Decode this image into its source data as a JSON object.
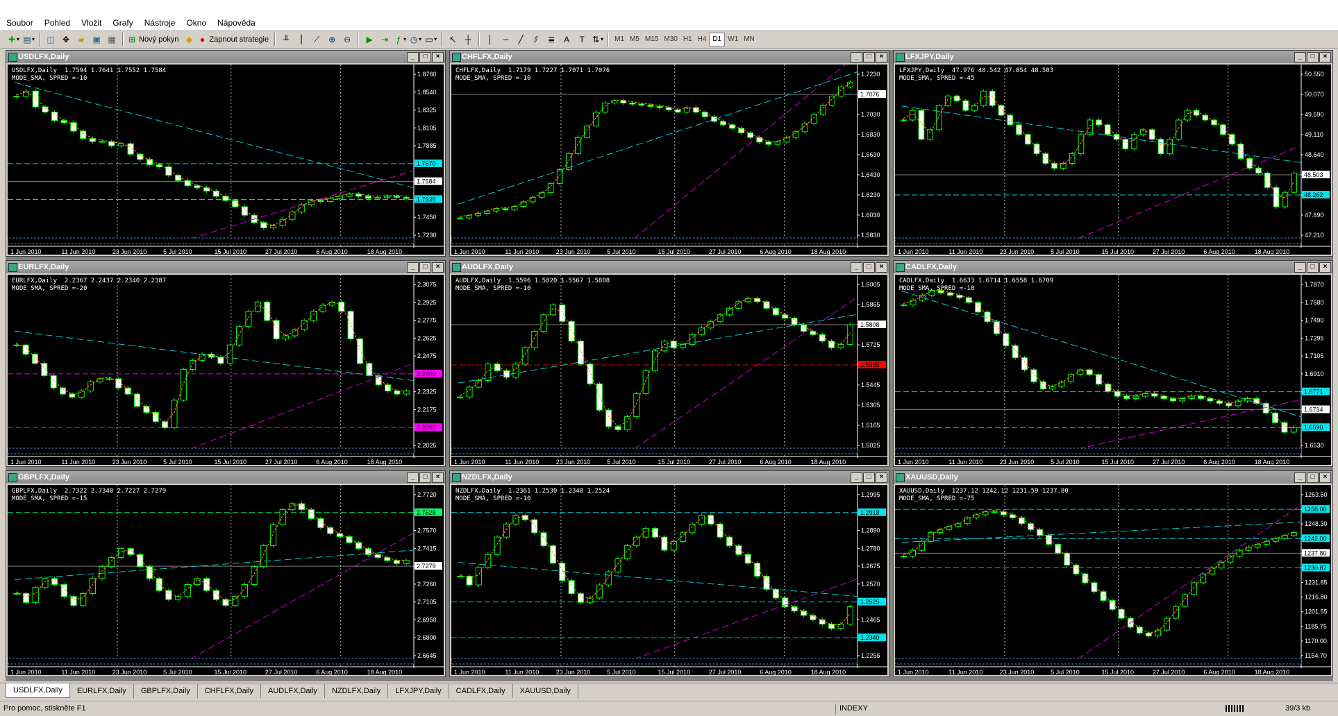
{
  "menu": [
    "Soubor",
    "Pohled",
    "Vložit",
    "Grafy",
    "Nástroje",
    "Okno",
    "Nápověda"
  ],
  "toolbar": {
    "new_order_label": "Nový pokyn",
    "autotrade_label": "Zapnout strategie",
    "timeframes": [
      "M1",
      "M5",
      "M15",
      "M30",
      "H1",
      "H4",
      "D1",
      "W1",
      "MN"
    ],
    "active_timeframe": "D1"
  },
  "date_labels": [
    "1 Jun 2010",
    "11 Jun 2010",
    "23 Jun 2010",
    "5 Jul 2010",
    "15 Jul 2010",
    "27 Jul 2010",
    "6 Aug 2010",
    "18 Aug 2010"
  ],
  "charts": [
    {
      "title": "USDLFX,Daily",
      "info": "USDLFX,Daily  1.7594 1.7641 1.7552 1.7584",
      "mode": "MODE_SMA, SPRED =-10",
      "price_labels": [
        "1.8760",
        "1.8540",
        "1.8325",
        "1.8105",
        "1.7885",
        "1.7670",
        "1.7584",
        "1.7535",
        "1.7450",
        "1.7230"
      ],
      "highlight_labels": [
        {
          "text": "1.7670",
          "color": "#00e5ee"
        },
        {
          "text": "1.7584",
          "color": "#ffffff"
        },
        {
          "text": "1.7535",
          "color": "#00e5ee"
        }
      ],
      "chart_data": {
        "type": "candlestick",
        "ymin": 1.723,
        "ymax": 1.876,
        "trend": [
          1.855,
          1.86,
          1.845,
          1.84,
          1.832,
          1.83,
          1.822,
          1.815,
          1.812,
          1.812,
          1.808,
          1.81,
          1.8,
          1.795,
          1.79,
          1.788,
          1.78,
          1.775,
          1.77,
          1.768,
          1.765,
          1.76,
          1.756,
          1.75,
          1.742,
          1.735,
          1.73,
          1.732,
          1.738,
          1.745,
          1.752,
          1.756,
          1.755,
          1.758,
          1.76,
          1.762,
          1.76,
          1.758,
          1.759,
          1.76,
          1.759,
          1.758
        ]
      }
    },
    {
      "title": "CHFLFX,Daily",
      "info": "CHFLFX,Daily  1.7179 1.7227 1.7071 1.7076",
      "mode": "MODE_SMA, SPRED =-10",
      "price_labels": [
        "1.7230",
        "1.7076",
        "1.7030",
        "1.6830",
        "1.6630",
        "1.6430",
        "1.6230",
        "1.6030",
        "1.5830"
      ],
      "highlight_labels": [
        {
          "text": "1.7076",
          "color": "#ffffff"
        }
      ],
      "chart_data": {
        "type": "candlestick",
        "ymin": 1.583,
        "ymax": 1.723,
        "trend": [
          1.598,
          1.6,
          1.602,
          1.604,
          1.606,
          1.605,
          1.608,
          1.612,
          1.616,
          1.62,
          1.628,
          1.64,
          1.654,
          1.668,
          1.678,
          1.69,
          1.698,
          1.7,
          1.698,
          1.697,
          1.696,
          1.695,
          1.694,
          1.692,
          1.69,
          1.694,
          1.69,
          1.686,
          1.682,
          1.679,
          1.676,
          1.672,
          1.668,
          1.664,
          1.662,
          1.664,
          1.668,
          1.673,
          1.68,
          1.688,
          1.696,
          1.704,
          1.712,
          1.716
        ]
      }
    },
    {
      "title": "LFXJPY,Daily",
      "info": "LFXJPY,Daily  47.976 48.542 47.854 48.503",
      "mode": "MODE_SMA, SPRED =-45",
      "price_labels": [
        "50.550",
        "50.070",
        "49.590",
        "49.110",
        "48.640",
        "48.503",
        "48.262",
        "47.690",
        "47.210"
      ],
      "highlight_labels": [
        {
          "text": "48.503",
          "color": "#ffffff"
        },
        {
          "text": "48.262",
          "color": "#00e5ee"
        }
      ],
      "chart_data": {
        "type": "candlestick",
        "ymin": 47.21,
        "ymax": 50.55,
        "trend": [
          49.6,
          49.8,
          49.2,
          49.4,
          49.9,
          50.1,
          50.0,
          49.8,
          49.9,
          50.2,
          49.9,
          49.7,
          49.5,
          49.3,
          49.1,
          48.9,
          48.7,
          48.6,
          48.7,
          48.9,
          49.3,
          49.6,
          49.5,
          49.3,
          49.2,
          49.0,
          49.3,
          49.4,
          49.2,
          48.9,
          49.2,
          49.6,
          49.8,
          49.7,
          49.6,
          49.5,
          49.3,
          49.1,
          48.8,
          48.6,
          48.5,
          48.2,
          47.8,
          48.1,
          48.5
        ]
      }
    },
    {
      "title": "EURLFX,Daily",
      "info": "EURLFX,Daily  2.2367 2.2437 2.2340 2.2387",
      "mode": "MODE_SMA, SPRED =-20",
      "price_labels": [
        "2.3075",
        "2.2925",
        "2.2775",
        "2.2625",
        "2.2475",
        "2.2400",
        "2.2325",
        "2.2175",
        "2.2098",
        "2.2025"
      ],
      "highlight_labels": [
        {
          "text": "2.2400",
          "color": "#ff00ff"
        },
        {
          "text": "2.2098",
          "color": "#ff00ff"
        }
      ],
      "chart_data": {
        "type": "candlestick",
        "ymin": 2.2025,
        "ymax": 2.3075,
        "trend": [
          2.268,
          2.262,
          2.256,
          2.248,
          2.24,
          2.236,
          2.234,
          2.238,
          2.244,
          2.246,
          2.246,
          2.24,
          2.236,
          2.228,
          2.224,
          2.218,
          2.214,
          2.232,
          2.252,
          2.258,
          2.262,
          2.26,
          2.256,
          2.268,
          2.28,
          2.29,
          2.296,
          2.284,
          2.272,
          2.274,
          2.278,
          2.284,
          2.29,
          2.294,
          2.296,
          2.29,
          2.272,
          2.256,
          2.248,
          2.242,
          2.238,
          2.236,
          2.238
        ]
      }
    },
    {
      "title": "AUDLFX,Daily",
      "info": "AUDLFX,Daily  1.5596 1.5820 1.5567 1.5808",
      "mode": "MODE_SMA, SPRED =-10",
      "price_labels": [
        "1.6005",
        "1.5865",
        "1.5808",
        "1.5725",
        "1.5585",
        "1.5445",
        "1.5305",
        "1.5165",
        "1.5025"
      ],
      "highlight_labels": [
        {
          "text": "1.5808",
          "color": "#ffffff"
        },
        {
          "text": "1.5585",
          "color": "#ff0000"
        }
      ],
      "chart_data": {
        "type": "candlestick",
        "ymin": 1.5025,
        "ymax": 1.6005,
        "trend": [
          1.532,
          1.538,
          1.542,
          1.552,
          1.548,
          1.544,
          1.552,
          1.562,
          1.572,
          1.582,
          1.588,
          1.578,
          1.566,
          1.552,
          1.54,
          1.524,
          1.514,
          1.512,
          1.52,
          1.534,
          1.548,
          1.56,
          1.566,
          1.562,
          1.564,
          1.57,
          1.574,
          1.578,
          1.582,
          1.586,
          1.59,
          1.592,
          1.59,
          1.586,
          1.582,
          1.58,
          1.576,
          1.572,
          1.57,
          1.566,
          1.562,
          1.564,
          1.576
        ]
      }
    },
    {
      "title": "CADLFX,Daily",
      "info": "CADLFX,Daily  1.6633 1.6714 1.6558 1.6709",
      "mode": "MODE_SMA, SPRED =-10",
      "price_labels": [
        "1.7870",
        "1.7680",
        "1.7490",
        "1.7295",
        "1.7105",
        "1.6910",
        "1.6771",
        "1.6734",
        "1.6590",
        "1.6530"
      ],
      "highlight_labels": [
        {
          "text": "1.6771",
          "color": "#00e5ee"
        },
        {
          "text": "1.6734",
          "color": "#ffffff"
        },
        {
          "text": "1.6590",
          "color": "#00e5ee"
        }
      ],
      "chart_data": {
        "type": "candlestick",
        "ymin": 1.653,
        "ymax": 1.787,
        "trend": [
          1.77,
          1.774,
          1.778,
          1.782,
          1.78,
          1.778,
          1.776,
          1.772,
          1.764,
          1.756,
          1.746,
          1.736,
          1.726,
          1.716,
          1.706,
          1.7,
          1.702,
          1.706,
          1.712,
          1.716,
          1.712,
          1.704,
          1.698,
          1.694,
          1.692,
          1.694,
          1.696,
          1.694,
          1.692,
          1.69,
          1.692,
          1.694,
          1.692,
          1.69,
          1.688,
          1.686,
          1.69,
          1.692,
          1.688,
          1.68,
          1.672,
          1.664,
          1.668
        ]
      }
    },
    {
      "title": "GBPLFX,Daily",
      "info": "GBPLFX,Daily  2.7322 2.7340 2.7227 2.7279",
      "mode": "MODE_SMA, SPRED =-15",
      "price_labels": [
        "2.7720",
        "2.7628",
        "2.7570",
        "2.7415",
        "2.7279",
        "2.7260",
        "2.7105",
        "2.6950",
        "2.6800",
        "2.6645"
      ],
      "highlight_labels": [
        {
          "text": "2.7628",
          "color": "#00ff66"
        },
        {
          "text": "2.7279",
          "color": "#ffffff"
        }
      ],
      "chart_data": {
        "type": "candlestick",
        "ymin": 2.6645,
        "ymax": 2.772,
        "trend": [
          2.706,
          2.7,
          2.71,
          2.716,
          2.712,
          2.704,
          2.698,
          2.706,
          2.716,
          2.724,
          2.73,
          2.736,
          2.732,
          2.724,
          2.716,
          2.708,
          2.702,
          2.704,
          2.712,
          2.716,
          2.708,
          2.702,
          2.698,
          2.704,
          2.712,
          2.724,
          2.738,
          2.752,
          2.762,
          2.766,
          2.762,
          2.756,
          2.75,
          2.746,
          2.744,
          2.74,
          2.736,
          2.732,
          2.73,
          2.728,
          2.726,
          2.728
        ]
      }
    },
    {
      "title": "NZDLFX,Daily",
      "info": "NZDLFX,Daily  1.2361 1.2530 1.2348 1.2524",
      "mode": "MODE_SMA, SPRED =-10",
      "price_labels": [
        "1.2995",
        "1.2918",
        "1.2890",
        "1.2780",
        "1.2675",
        "1.2570",
        "1.2525",
        "1.2465",
        "1.2340",
        "1.2255"
      ],
      "highlight_labels": [
        {
          "text": "1.2918",
          "color": "#00e5ee"
        },
        {
          "text": "1.2525",
          "color": "#00e5ee"
        },
        {
          "text": "1.2340",
          "color": "#00e5ee"
        }
      ],
      "chart_data": {
        "type": "candlestick",
        "ymin": 1.2255,
        "ymax": 1.2995,
        "trend": [
          1.262,
          1.258,
          1.266,
          1.272,
          1.28,
          1.286,
          1.29,
          1.288,
          1.282,
          1.276,
          1.268,
          1.26,
          1.254,
          1.25,
          1.252,
          1.258,
          1.264,
          1.27,
          1.276,
          1.28,
          1.284,
          1.28,
          1.274,
          1.278,
          1.282,
          1.286,
          1.29,
          1.286,
          1.28,
          1.276,
          1.272,
          1.268,
          1.262,
          1.256,
          1.252,
          1.248,
          1.246,
          1.244,
          1.242,
          1.24,
          1.238,
          1.24,
          1.248
        ]
      }
    },
    {
      "title": "XAUUSD,Daily",
      "info": "XAUUSD,Daily  1237.12 1242.12 1231.59 1237.80",
      "mode": "MODE_SMA, SPRED =-75",
      "price_labels": [
        "1263.60",
        "1258.00",
        "1248.30",
        "1242.00",
        "1237.80",
        "1230.87",
        "1231.85",
        "1216.80",
        "1201.55",
        "1185.75",
        "1170.00",
        "1154.70"
      ],
      "highlight_labels": [
        {
          "text": "1258.00",
          "color": "#00e5ee"
        },
        {
          "text": "1242.00",
          "color": "#00e5ee"
        },
        {
          "text": "1237.80",
          "color": "#ffffff"
        },
        {
          "text": "1230.87",
          "color": "#00e5ee"
        }
      ],
      "chart_data": {
        "type": "candlestick",
        "ymin": 1154.7,
        "ymax": 1263.6,
        "trend": [
          1222,
          1226,
          1232,
          1238,
          1240,
          1242,
          1244,
          1248,
          1250,
          1252,
          1252,
          1250,
          1248,
          1244,
          1240,
          1236,
          1230,
          1224,
          1216,
          1210,
          1204,
          1198,
          1192,
          1186,
          1180,
          1174,
          1170,
          1168,
          1172,
          1180,
          1188,
          1196,
          1204,
          1210,
          1214,
          1218,
          1222,
          1226,
          1228,
          1230,
          1232,
          1234,
          1236,
          1238
        ]
      }
    }
  ],
  "bottom_tabs": [
    "USDLFX,Daily",
    "EURLFX,Daily",
    "GBPLFX,Daily",
    "CHFLFX,Daily",
    "AUDLFX,Daily",
    "NZDLFX,Daily",
    "LFXJPY,Daily",
    "CADLFX,Daily",
    "XAUUSD,Daily"
  ],
  "active_tab": "USDLFX,Daily",
  "status": {
    "help": "Pro pomoc, stiskněte F1",
    "profile": "INDEXY",
    "connection": "39/3 kb"
  }
}
